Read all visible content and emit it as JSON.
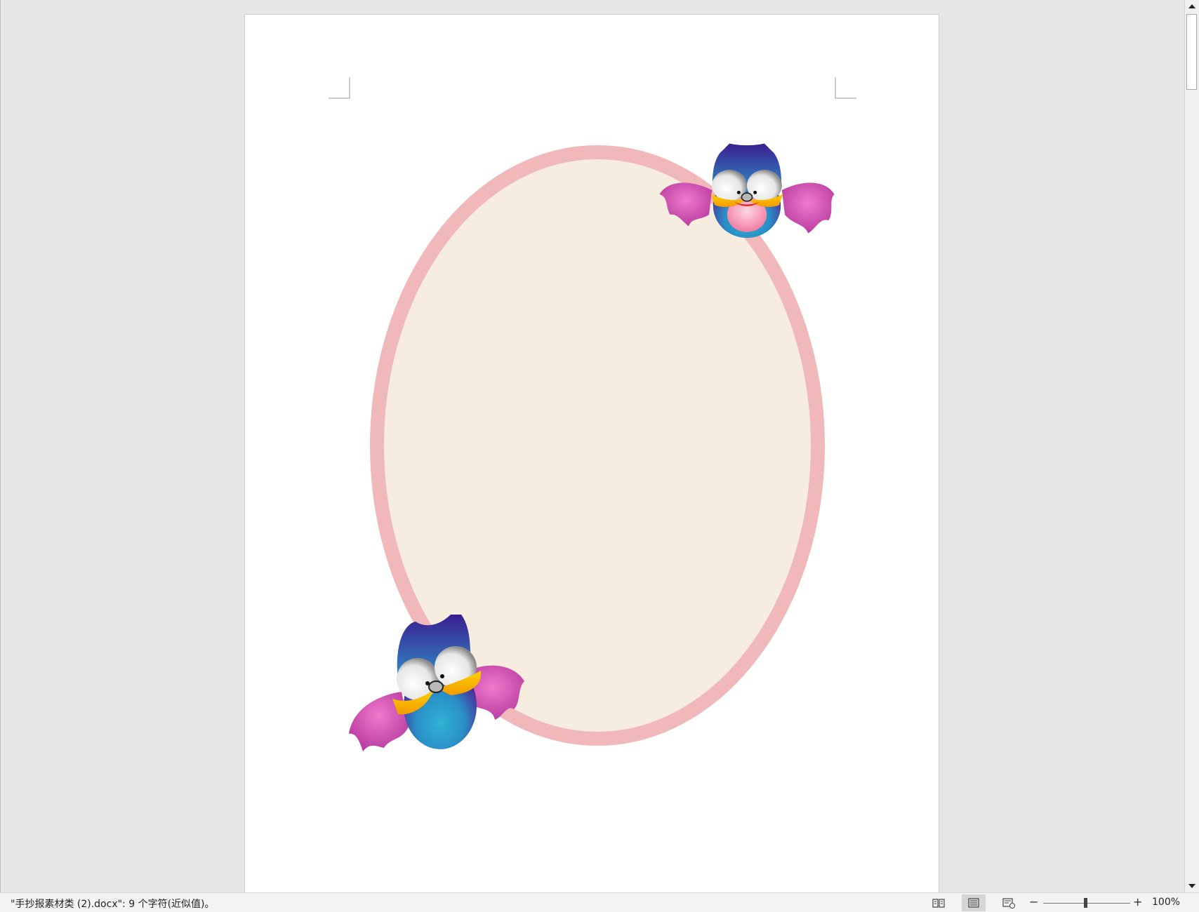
{
  "document": {
    "status_text": "\"手抄报素材类 (2).docx\": 9 个字符(近似值)。",
    "zoom_level": "100%",
    "zoom_minus_label": "−",
    "zoom_plus_label": "+"
  },
  "status_bar": {
    "views": [
      {
        "name": "read-mode-view",
        "icon": "book-icon",
        "active": false
      },
      {
        "name": "print-layout-view",
        "icon": "page-icon",
        "active": true
      },
      {
        "name": "web-layout-view",
        "icon": "web-page-icon",
        "active": false
      }
    ]
  },
  "colors": {
    "workspace": "#e6e6e6",
    "page": "#ffffff",
    "oval_border": "#f0b8b8",
    "oval_fill": "#f6eddf"
  }
}
